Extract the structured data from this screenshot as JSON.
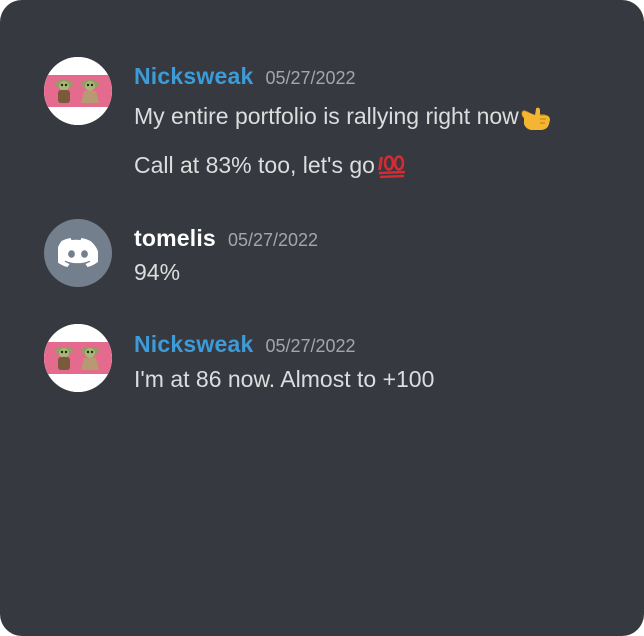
{
  "messages": [
    {
      "username": "Nicksweak",
      "timestamp": "05/27/2022",
      "name_color": "#3d9bd8",
      "avatar": "baby-yoda-avatar",
      "lines": [
        {
          "text": "My entire portfolio is rallying right now",
          "emoji": "call-me-hand-emoji"
        },
        {
          "text": "Call at 83% too, let's go",
          "emoji": "hundred-points-emoji"
        }
      ]
    },
    {
      "username": "tomelis",
      "timestamp": "05/27/2022",
      "name_color": "#ffffff",
      "avatar": "discord-logo-avatar",
      "lines": [
        {
          "text": "94%"
        }
      ]
    },
    {
      "username": "Nicksweak",
      "timestamp": "05/27/2022",
      "name_color": "#3d9bd8",
      "avatar": "baby-yoda-avatar",
      "lines": [
        {
          "text": "I'm at 86 now. Almost to +100"
        }
      ]
    }
  ],
  "colors": {
    "background": "#36393f",
    "message_text": "#dcddde",
    "timestamp": "#a3a6aa",
    "discord_avatar_bg": "#747f8d"
  }
}
